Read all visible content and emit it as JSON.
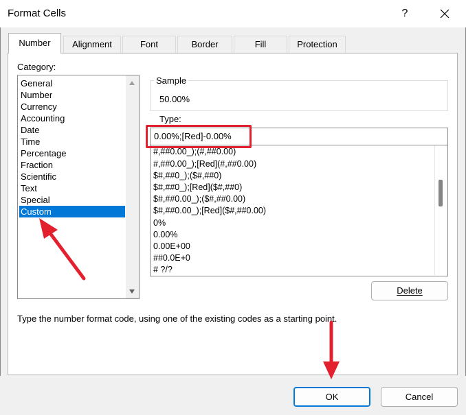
{
  "window": {
    "title": "Format Cells",
    "help_label": "?"
  },
  "tabs": [
    {
      "label": "Number",
      "active": true
    },
    {
      "label": "Alignment",
      "active": false
    },
    {
      "label": "Font",
      "active": false
    },
    {
      "label": "Border",
      "active": false
    },
    {
      "label": "Fill",
      "active": false
    },
    {
      "label": "Protection",
      "active": false
    }
  ],
  "category": {
    "label": "Category:",
    "items": [
      "General",
      "Number",
      "Currency",
      "Accounting",
      "Date",
      "Time",
      "Percentage",
      "Fraction",
      "Scientific",
      "Text",
      "Special",
      "Custom"
    ],
    "selected": "Custom"
  },
  "sample": {
    "label": "Sample",
    "value": "50.00%"
  },
  "type": {
    "label": "Type:",
    "value": "0.00%;[Red]-0.00%",
    "formats": [
      "#,##0.00_);(#,##0.00)",
      "#,##0.00_);[Red](#,##0.00)",
      "$#,##0_);($#,##0)",
      "$#,##0_);[Red]($#,##0)",
      "$#,##0.00_);($#,##0.00)",
      "$#,##0.00_);[Red]($#,##0.00)",
      "0%",
      "0.00%",
      "0.00E+00",
      "##0.0E+0",
      "# ?/?"
    ]
  },
  "buttons": {
    "delete": "Delete",
    "ok": "OK",
    "cancel": "Cancel"
  },
  "hint": "Type the number format code, using one of the existing codes as a starting point.",
  "colors": {
    "accent": "#0078d7",
    "annotation": "#e3202e"
  }
}
